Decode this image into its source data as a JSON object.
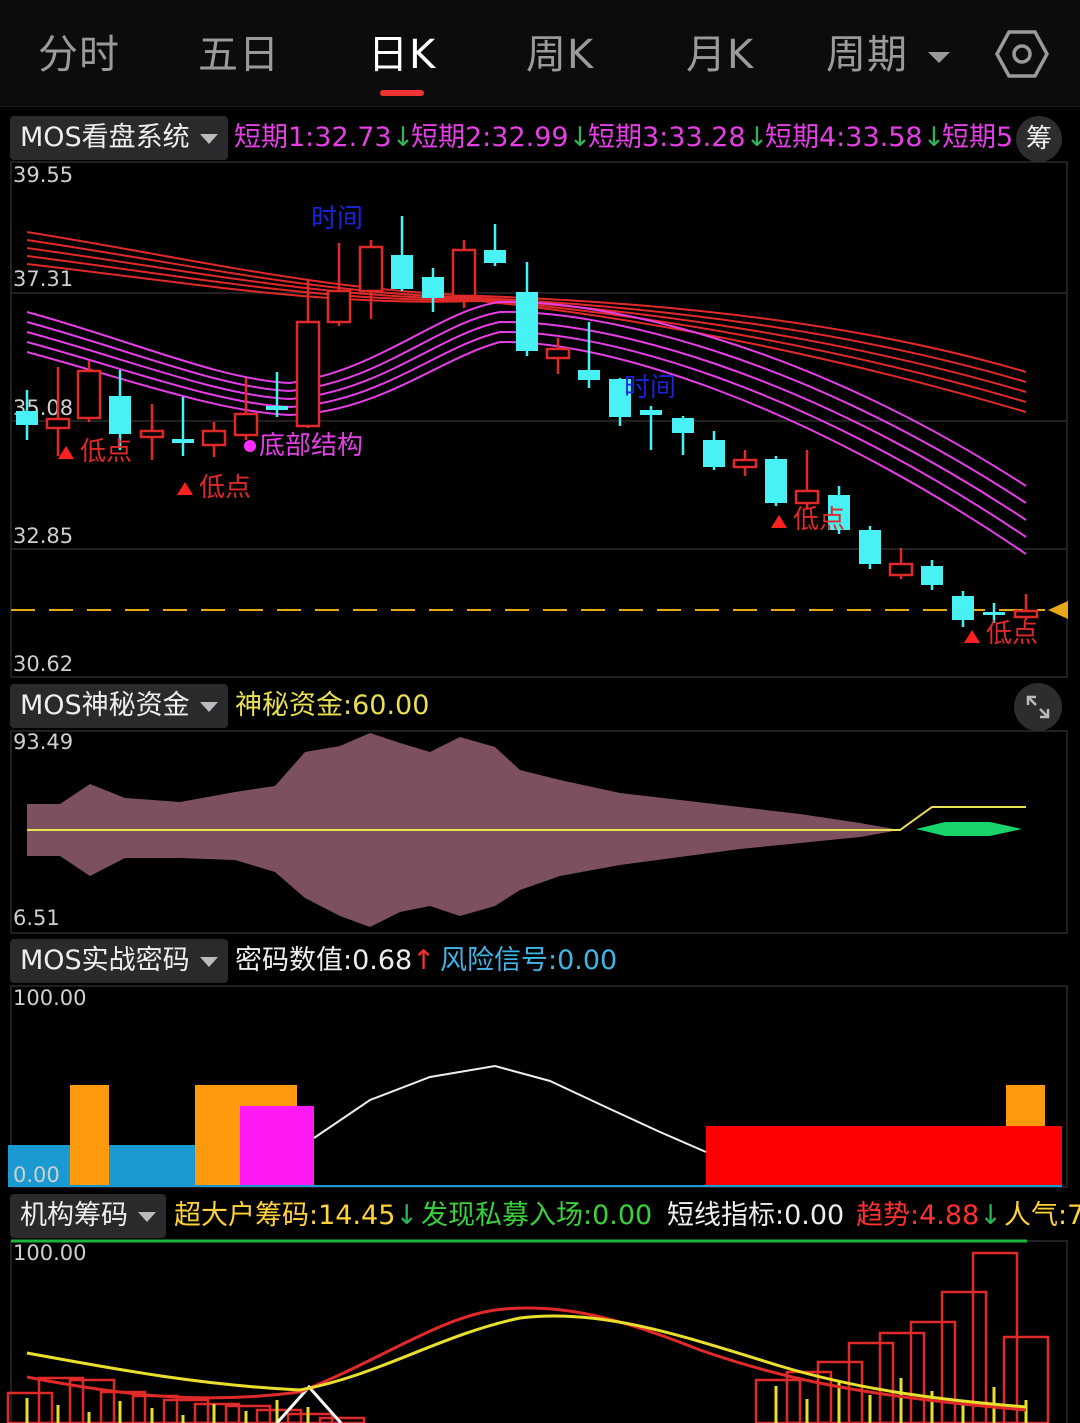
{
  "tabs": [
    {
      "label": "分时",
      "active": false
    },
    {
      "label": "五日",
      "active": false
    },
    {
      "label": "日K",
      "active": true
    },
    {
      "label": "周K",
      "active": false
    },
    {
      "label": "月K",
      "active": false
    },
    {
      "label": "周期",
      "active": false
    }
  ],
  "main": {
    "selector": "MOS看盘系统",
    "indicators": [
      {
        "text": "短期1:32.73",
        "arrow": "↓",
        "color": "#e53fe5"
      },
      {
        "text": "短期2:32.99",
        "arrow": "↓",
        "color": "#e53fe5"
      },
      {
        "text": "短期3:33.28",
        "arrow": "↓",
        "color": "#e53fe5"
      },
      {
        "text": "短期4:33.58",
        "arrow": "↓",
        "color": "#e53fe5"
      },
      {
        "text": "短期5",
        "arrow": "",
        "color": "#e53fe5"
      }
    ],
    "chip_button": "筹",
    "axis": [
      "39.55",
      "37.31",
      "35.08",
      "32.85",
      "30.62"
    ],
    "annotations": {
      "time1": "时间",
      "time2": "时间",
      "low1": "低点",
      "low2": "低点",
      "low3": "低点",
      "low4": "低点",
      "bottom": "底部结构"
    }
  },
  "mystery": {
    "selector": "MOS神秘资金",
    "label": "神秘资金:60.00",
    "axis": [
      "93.49",
      "6.51"
    ]
  },
  "code": {
    "selector": "MOS实战密码",
    "code_value": "密码数值:0.68",
    "code_arrow": "↑",
    "risk": "风险信号:0.00",
    "axis": [
      "100.00",
      "0.00"
    ]
  },
  "chips": {
    "selector": "机构筹码",
    "items": [
      {
        "text": "超大户筹码:14.45",
        "arrow": "↓",
        "color": "#ffd23a"
      },
      {
        "text": "发现私募入场:0.00",
        "arrow": "",
        "color": "#39d23c"
      },
      {
        "text": "短线指标:0.00",
        "arrow": "",
        "color": "#eeeeee"
      },
      {
        "text": "趋势:4.88",
        "arrow": "↓",
        "color": "#ff3030"
      },
      {
        "text": "人气:7",
        "arrow": "",
        "color": "#ffd23a"
      }
    ],
    "axis": [
      "100.00"
    ]
  },
  "colors": {
    "up": "#e02a2a",
    "down": "#48f1f4",
    "magenta": "#e53fe5",
    "accent": "#e33"
  }
}
